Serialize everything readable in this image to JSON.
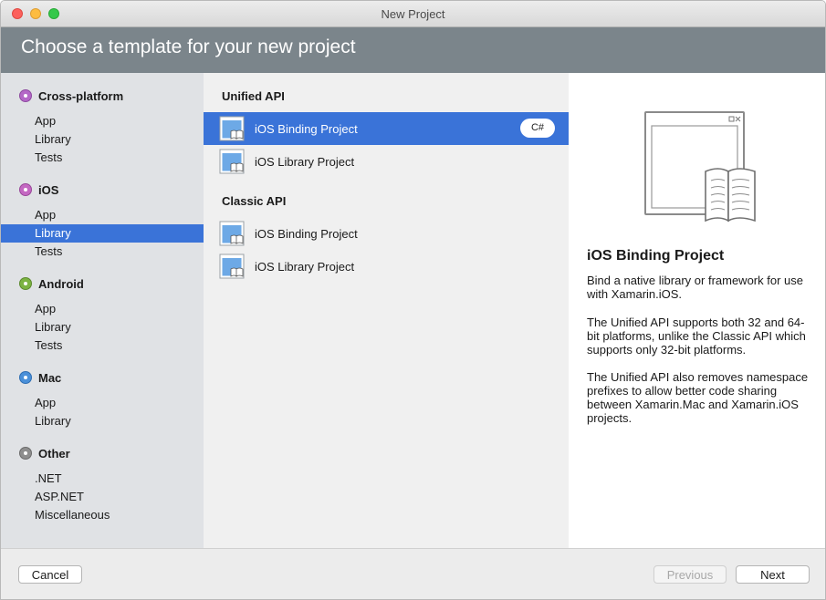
{
  "window": {
    "title": "New Project"
  },
  "header": {
    "title": "Choose a template for your new project"
  },
  "sidebar": {
    "categories": [
      {
        "label": "Cross-platform",
        "color": "#b467c7",
        "items": [
          "App",
          "Library",
          "Tests"
        ]
      },
      {
        "label": "iOS",
        "color": "#c468c2",
        "items": [
          "App",
          "Library",
          "Tests"
        ]
      },
      {
        "label": "Android",
        "color": "#7cb342",
        "items": [
          "App",
          "Library",
          "Tests"
        ]
      },
      {
        "label": "Mac",
        "color": "#4a90d9",
        "items": [
          "App",
          "Library"
        ]
      },
      {
        "label": "Other",
        "color": "#8e8e8e",
        "items": [
          ".NET",
          "ASP.NET",
          "Miscellaneous"
        ]
      }
    ],
    "selected": "iOS / Library"
  },
  "templates": {
    "unified": {
      "heading": "Unified API",
      "items": [
        {
          "label": "iOS Binding Project",
          "badge": "C#",
          "selected": true
        },
        {
          "label": "iOS Library Project"
        }
      ]
    },
    "classic": {
      "heading": "Classic API",
      "items": [
        {
          "label": "iOS Binding Project"
        },
        {
          "label": "iOS Library Project"
        }
      ]
    }
  },
  "detail": {
    "title": "iOS Binding Project",
    "paragraphs": [
      "Bind a native library or framework for use with Xamarin.iOS.",
      "The Unified API supports both 32 and 64-bit platforms, unlike the Classic API which supports only 32-bit platforms.",
      "The Unified API also removes namespace prefixes to allow better code sharing between Xamarin.Mac and Xamarin.iOS projects."
    ]
  },
  "footer": {
    "cancel": "Cancel",
    "previous": "Previous",
    "next": "Next"
  },
  "colors": {
    "accent": "#3a73d8",
    "header": "#7b858b"
  },
  "icons": {
    "template": "project-template-icon",
    "preview": "window-book-preview-icon"
  }
}
